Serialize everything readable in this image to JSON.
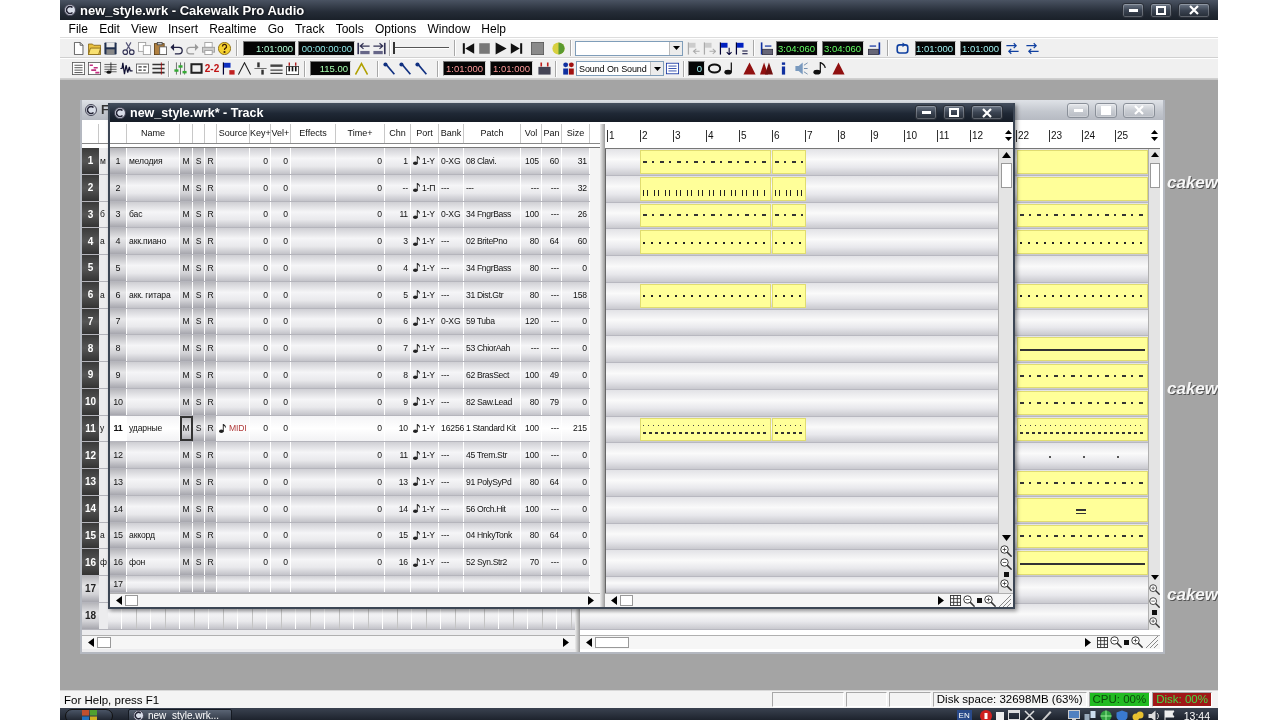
{
  "window": {
    "title": "new_style.wrk - Cakewalk Pro Audio"
  },
  "menu": [
    "File",
    "Edit",
    "View",
    "Insert",
    "Realtime",
    "Go",
    "Track",
    "Tools",
    "Options",
    "Window",
    "Help"
  ],
  "toolbar": {
    "now_time": "1:01:000",
    "now_smpte": "00:00:00:00",
    "position": {
      "level": 0
    },
    "from_time": "3:04:060",
    "thru_time": "3:04:060",
    "loop_start": "1:01:000",
    "loop_end": "1:01:000",
    "snap": "2-2",
    "tempo": "115.00",
    "punch_in": "1:01:000",
    "punch_out": "1:01:000",
    "record_mode": "Sound On Sound",
    "step": "0"
  },
  "background_window": {
    "title": "F",
    "ruler": [
      "22",
      "23",
      "24",
      "25"
    ],
    "rows": [
      {
        "number": "1",
        "selected": true,
        "name": "м",
        "clip": {
          "kind": "empty"
        }
      },
      {
        "number": "2",
        "selected": true,
        "clip": {
          "kind": "empty"
        }
      },
      {
        "number": "3",
        "selected": true,
        "name": "б",
        "clip": {
          "kind": "dashes"
        }
      },
      {
        "number": "4",
        "selected": true,
        "name": "а",
        "clip": {
          "kind": "dots"
        }
      },
      {
        "number": "5",
        "selected": true
      },
      {
        "number": "6",
        "selected": true,
        "name": "а",
        "clip": {
          "kind": "dots"
        }
      },
      {
        "number": "7",
        "selected": true
      },
      {
        "number": "8",
        "selected": true,
        "clip": {
          "kind": "line"
        }
      },
      {
        "number": "9",
        "selected": true,
        "clip": {
          "kind": "dashes"
        }
      },
      {
        "number": "10",
        "selected": true,
        "clip": {
          "kind": "dashes"
        }
      },
      {
        "number": "11",
        "selected": true,
        "name": "у",
        "clip": {
          "kind": "double"
        }
      },
      {
        "number": "12",
        "selected": true,
        "clip": {
          "kind": "sparse"
        }
      },
      {
        "number": "13",
        "selected": true,
        "clip": {
          "kind": "dashes"
        }
      },
      {
        "number": "14",
        "selected": true,
        "clip": {
          "kind": "marks"
        }
      },
      {
        "number": "15",
        "selected": true,
        "name": "а",
        "clip": {
          "kind": "dashes"
        }
      },
      {
        "number": "16",
        "selected": true,
        "name": "ф",
        "clip": {
          "kind": "line"
        }
      },
      {
        "number": "17",
        "selected": false
      },
      {
        "number": "18",
        "selected": false
      }
    ]
  },
  "track_window": {
    "title": "new_style.wrk* - Track",
    "columns": [
      "Name",
      "Source",
      "Key+",
      "Vel+",
      "Effects",
      "Time+",
      "Chn",
      "Port",
      "Bank",
      "Patch",
      "Vol",
      "Pan",
      "Size"
    ],
    "ruler": [
      "1",
      "2",
      "3",
      "4",
      "5",
      "6",
      "7",
      "8",
      "9",
      "10",
      "11",
      "12"
    ],
    "rows": [
      {
        "number": "1",
        "name": "мелодия",
        "mute": "M",
        "solo": "S",
        "arm": "R",
        "key": "0",
        "vel": "0",
        "time": "0",
        "chn": "1",
        "port": "1-Y",
        "bank": "0-XG",
        "patch": "08 Clavi.",
        "vol": "105",
        "pan": "60",
        "size": "31",
        "current": false,
        "clip": {
          "kind": "dashes"
        }
      },
      {
        "number": "2",
        "mute": "M",
        "solo": "S",
        "arm": "R",
        "key": "0",
        "vel": "0",
        "time": "0",
        "chn": "--",
        "port": "1-П",
        "bank": "---",
        "patch": "---",
        "vol": "---",
        "pan": "---",
        "size": "32",
        "current": false,
        "clip": {
          "kind": "ticks"
        }
      },
      {
        "number": "3",
        "name": "бас",
        "mute": "M",
        "solo": "S",
        "arm": "R",
        "key": "0",
        "vel": "0",
        "time": "0",
        "chn": "11",
        "port": "1-Y",
        "bank": "0-XG",
        "patch": "34 FngrBass",
        "vol": "100",
        "pan": "---",
        "size": "26",
        "current": false,
        "clip": {
          "kind": "dashes"
        }
      },
      {
        "number": "4",
        "name": "акк.пиано",
        "mute": "M",
        "solo": "S",
        "arm": "R",
        "key": "0",
        "vel": "0",
        "time": "0",
        "chn": "3",
        "port": "1-Y",
        "bank": "---",
        "patch": "02 BritePno",
        "vol": "80",
        "pan": "64",
        "size": "60",
        "current": false,
        "clip": {
          "kind": "dots"
        }
      },
      {
        "number": "5",
        "mute": "M",
        "solo": "S",
        "arm": "R",
        "key": "0",
        "vel": "0",
        "time": "0",
        "chn": "4",
        "port": "1-Y",
        "bank": "---",
        "patch": "34 FngrBass",
        "vol": "80",
        "pan": "---",
        "size": "0",
        "current": false
      },
      {
        "number": "6",
        "name": "акк. гитара",
        "mute": "M",
        "solo": "S",
        "arm": "R",
        "key": "0",
        "vel": "0",
        "time": "0",
        "chn": "5",
        "port": "1-Y",
        "bank": "---",
        "patch": "31 Dist.Gtr",
        "vol": "80",
        "pan": "---",
        "size": "158",
        "current": false,
        "clip": {
          "kind": "dots"
        }
      },
      {
        "number": "7",
        "mute": "M",
        "solo": "S",
        "arm": "R",
        "key": "0",
        "vel": "0",
        "time": "0",
        "chn": "6",
        "port": "1-Y",
        "bank": "0-XG",
        "patch": "59 Tuba",
        "vol": "120",
        "pan": "---",
        "size": "0",
        "current": false
      },
      {
        "number": "8",
        "mute": "M",
        "solo": "S",
        "arm": "R",
        "key": "0",
        "vel": "0",
        "time": "0",
        "chn": "7",
        "port": "1-Y",
        "bank": "---",
        "patch": "53 ChiorAah",
        "vol": "---",
        "pan": "---",
        "size": "0",
        "current": false
      },
      {
        "number": "9",
        "mute": "M",
        "solo": "S",
        "arm": "R",
        "key": "0",
        "vel": "0",
        "time": "0",
        "chn": "8",
        "port": "1-Y",
        "bank": "---",
        "patch": "62 BrasSect",
        "vol": "100",
        "pan": "49",
        "size": "0",
        "current": false
      },
      {
        "number": "10",
        "mute": "M",
        "solo": "S",
        "arm": "R",
        "key": "0",
        "vel": "0",
        "time": "0",
        "chn": "9",
        "port": "1-Y",
        "bank": "---",
        "patch": "82 Saw.Lead",
        "vol": "80",
        "pan": "79",
        "size": "0",
        "current": false
      },
      {
        "number": "11",
        "name": "ударные",
        "mute": "M",
        "solo": "S",
        "arm": "R",
        "source": "MIDI",
        "key": "0",
        "vel": "0",
        "time": "0",
        "chn": "10",
        "port": "1-Y",
        "bank": "16256",
        "patch": "1 Standard Kit",
        "vol": "100",
        "pan": "---",
        "size": "215",
        "current": true,
        "clip": {
          "kind": "double"
        }
      },
      {
        "number": "12",
        "mute": "M",
        "solo": "S",
        "arm": "R",
        "key": "0",
        "vel": "0",
        "time": "0",
        "chn": "11",
        "port": "1-Y",
        "bank": "---",
        "patch": "45 Trem.Str",
        "vol": "100",
        "pan": "---",
        "size": "0",
        "current": false
      },
      {
        "number": "13",
        "mute": "M",
        "solo": "S",
        "arm": "R",
        "key": "0",
        "vel": "0",
        "time": "0",
        "chn": "13",
        "port": "1-Y",
        "bank": "---",
        "patch": "91 PolySyPd",
        "vol": "80",
        "pan": "64",
        "size": "0",
        "current": false
      },
      {
        "number": "14",
        "mute": "M",
        "solo": "S",
        "arm": "R",
        "key": "0",
        "vel": "0",
        "time": "0",
        "chn": "14",
        "port": "1-Y",
        "bank": "---",
        "patch": "56 Orch.Hit",
        "vol": "100",
        "pan": "---",
        "size": "0",
        "current": false
      },
      {
        "number": "15",
        "name": "аккорд",
        "mute": "M",
        "solo": "S",
        "arm": "R",
        "key": "0",
        "vel": "0",
        "time": "0",
        "chn": "15",
        "port": "1-Y",
        "bank": "---",
        "patch": "04 HnkyTonk",
        "vol": "80",
        "pan": "64",
        "size": "0",
        "current": false
      },
      {
        "number": "16",
        "name": "фон",
        "mute": "M",
        "solo": "S",
        "arm": "R",
        "key": "0",
        "vel": "0",
        "time": "0",
        "chn": "16",
        "port": "1-Y",
        "bank": "---",
        "patch": "52 Syn.Str2",
        "vol": "70",
        "pan": "---",
        "size": "0",
        "current": false
      },
      {
        "number": "17",
        "current": false
      }
    ]
  },
  "logos": [
    "cakew",
    "cakew",
    "cakew"
  ],
  "status_bar": {
    "help": "For Help, press F1",
    "panels": [
      {
        "text": "Disk space: 32698MB (63%)"
      },
      {
        "text": "CPU: 00%",
        "color": "#22bb22"
      },
      {
        "text": "Disk: 00%",
        "color": "#a01818"
      }
    ]
  },
  "taskbar": {
    "task": "new_style.wrk...",
    "language": "EN",
    "clock": "13:44"
  }
}
